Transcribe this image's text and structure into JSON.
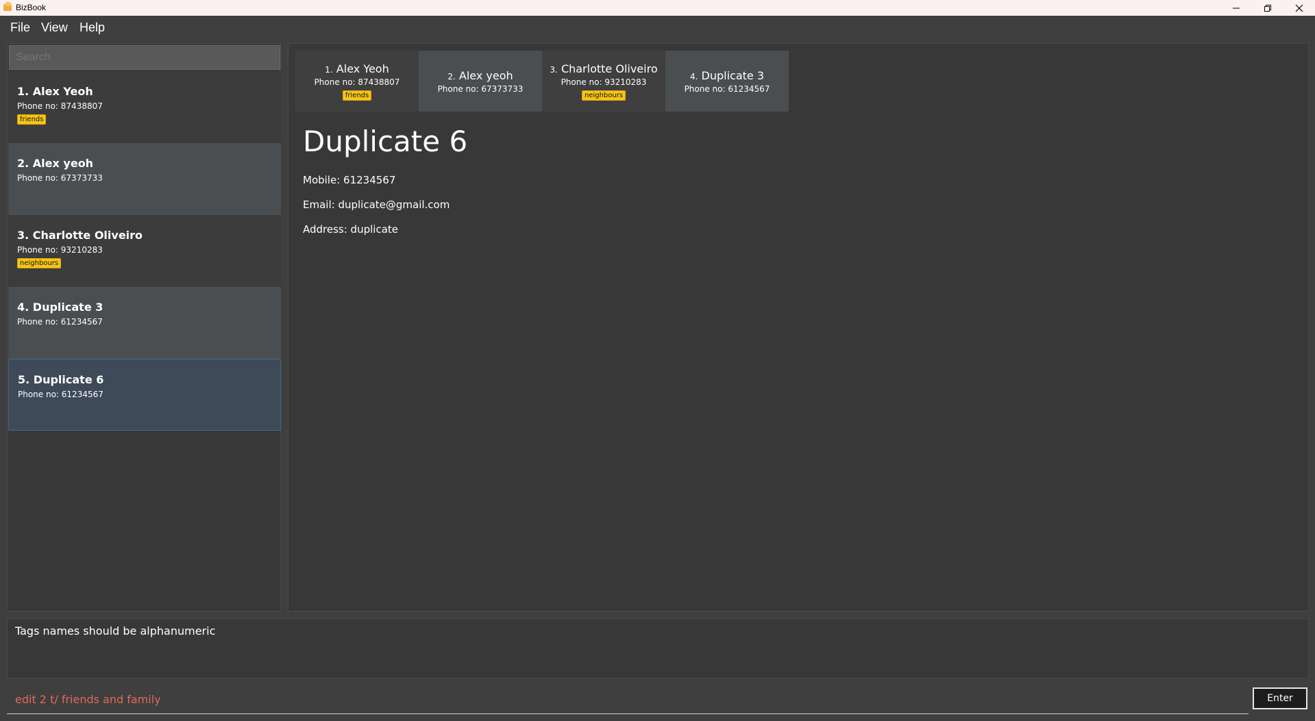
{
  "window": {
    "title": "BizBook",
    "controls": {
      "minimize": "minimize-icon",
      "maximize": "restore-icon",
      "close": "close-icon"
    }
  },
  "menu": {
    "file": "File",
    "view": "View",
    "help": "Help"
  },
  "search": {
    "placeholder": "Search"
  },
  "list": [
    {
      "index": "1.",
      "name": "Alex Yeoh",
      "phone": "Phone no: 87438807",
      "tag": "friends"
    },
    {
      "index": "2.",
      "name": "Alex yeoh",
      "phone": "Phone no: 67373733",
      "tag": ""
    },
    {
      "index": "3.",
      "name": "Charlotte Oliveiro",
      "phone": "Phone no: 93210283",
      "tag": "neighbours"
    },
    {
      "index": "4.",
      "name": "Duplicate 3",
      "phone": "Phone no: 61234567",
      "tag": ""
    },
    {
      "index": "5.",
      "name": "Duplicate 6",
      "phone": "Phone no: 61234567",
      "tag": ""
    }
  ],
  "tabs": [
    {
      "index": "1.",
      "name": "Alex Yeoh",
      "phone": "Phone no: 87438807",
      "tag": "friends"
    },
    {
      "index": "2.",
      "name": "Alex yeoh",
      "phone": "Phone no: 67373733",
      "tag": ""
    },
    {
      "index": "3.",
      "name": "Charlotte Oliveiro",
      "phone": "Phone no: 93210283",
      "tag": "neighbours"
    },
    {
      "index": "4.",
      "name": "Duplicate 3",
      "phone": "Phone no: 61234567",
      "tag": ""
    }
  ],
  "detail": {
    "name": "Duplicate 6",
    "mobile": "Mobile: 61234567",
    "email": "Email: duplicate@gmail.com",
    "address": "Address: duplicate"
  },
  "result": "Tags names should be alphanumeric",
  "command": {
    "value": "edit 2 t/ friends and family",
    "enter_label": "Enter"
  },
  "colors": {
    "accent_tag": "#f5c518",
    "command_text": "#e06a55",
    "selected_card": "#3f4a59"
  }
}
